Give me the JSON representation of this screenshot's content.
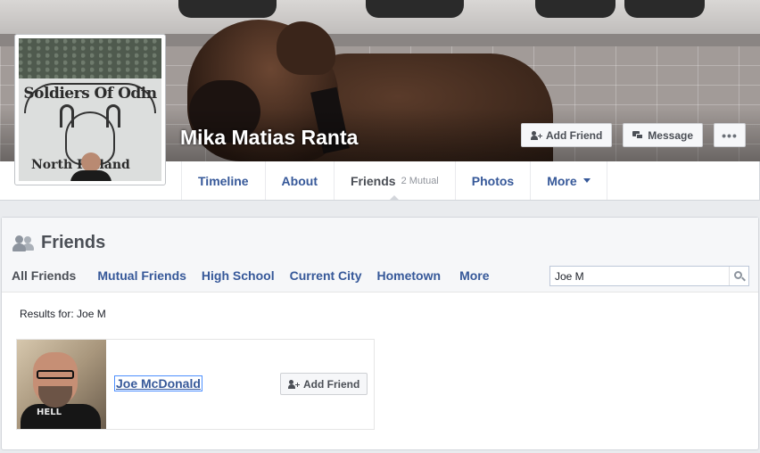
{
  "profile": {
    "name": "Mika Matias Ranta",
    "picture_text_top": "Soldiers Of Odin",
    "picture_text_bottom": "North Finland"
  },
  "cover_actions": {
    "add_friend_label": "Add Friend",
    "message_label": "Message",
    "more_label": "•••"
  },
  "tabs": [
    {
      "label": "Timeline"
    },
    {
      "label": "About"
    },
    {
      "label": "Friends",
      "sub": "2 Mutual",
      "active": true
    },
    {
      "label": "Photos"
    },
    {
      "label": "More"
    }
  ],
  "friends_section": {
    "title": "Friends",
    "subnav": [
      "All Friends",
      "Mutual Friends",
      "High School",
      "Current City",
      "Hometown",
      "More"
    ],
    "search": {
      "value": "Joe M"
    },
    "results_label": "Results for: Joe M",
    "results": [
      {
        "name": "Joe McDonald",
        "button_label": "Add Friend",
        "shirt_text": "HELL"
      }
    ]
  },
  "colors": {
    "link": "#365899",
    "page_bg": "#e9ebee",
    "panel_header_bg": "#f6f7f9"
  }
}
